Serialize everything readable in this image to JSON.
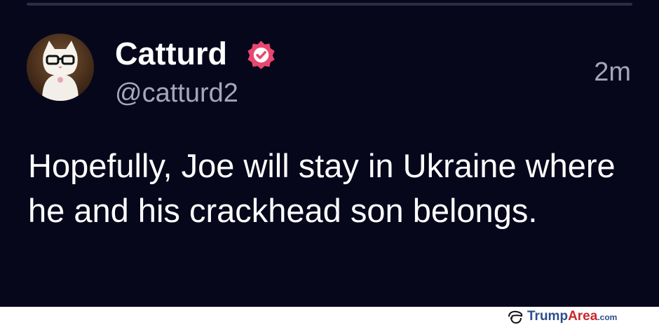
{
  "post": {
    "author_name": "Catturd",
    "author_handle": "@catturd2",
    "timestamp": "2m",
    "text": "Hopefully, Joe will stay in Ukraine where he and his crackhead son belongs.",
    "verified_badge_icon": "verified-check-badge-icon",
    "avatar_icon": "cat-with-glasses-avatar"
  },
  "watermark": {
    "brand_part1": "Trump",
    "brand_part2": "Area",
    "brand_domain": ".com",
    "icon": "trump-hair-logo-icon"
  },
  "colors": {
    "background": "#07071c",
    "badge": "#e8476f",
    "brand_blue": "#2d4d8c",
    "brand_red": "#c8262c"
  }
}
